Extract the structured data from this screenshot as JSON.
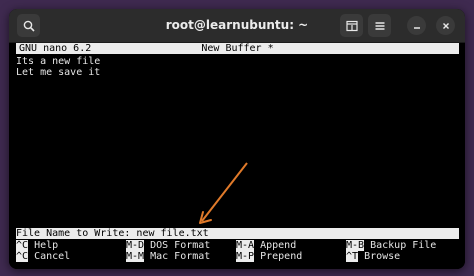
{
  "window": {
    "title": "root@learnubuntu: ~",
    "new_tab_icon": "new-tab-icon",
    "search_icon": "search-icon",
    "menu_icon": "hamburger-menu-icon",
    "minimize_icon": "minimize-icon",
    "close_icon": "close-icon"
  },
  "nano": {
    "version": "GNU nano 6.2",
    "buffer_name": "New Buffer *",
    "content": [
      "Its a new file",
      "Let me save it"
    ],
    "prompt_label": "File Name to Write: ",
    "prompt_value": "new file.txt",
    "shortcuts_row1": [
      {
        "key": "^C",
        "label": "Help"
      },
      {
        "key": "M-D",
        "label": "DOS Format"
      },
      {
        "key": "M-A",
        "label": "Append"
      },
      {
        "key": "M-B",
        "label": "Backup File"
      }
    ],
    "shortcuts_row2": [
      {
        "key": "^C",
        "label": "Cancel"
      },
      {
        "key": "M-M",
        "label": "Mac Format"
      },
      {
        "key": "M-P",
        "label": "Prepend"
      },
      {
        "key": "^T",
        "label": "Browse"
      }
    ]
  },
  "colors": {
    "desktop_bg": "#3f2a50",
    "titlebar_bg": "#2c2c2c",
    "terminal_bg": "#000000",
    "inverse_bg": "#ececec",
    "arrow": "#e07a2a"
  }
}
